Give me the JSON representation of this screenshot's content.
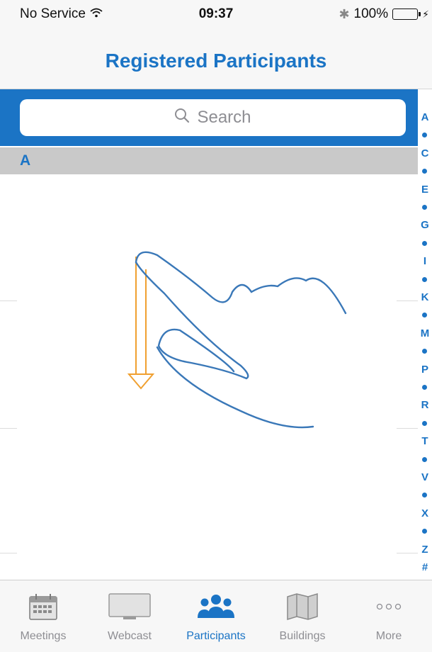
{
  "status_bar": {
    "carrier": "No Service",
    "time": "09:37",
    "battery": "100%"
  },
  "nav": {
    "title": "Registered Participants"
  },
  "search": {
    "placeholder": "Search"
  },
  "section": {
    "letter": "A"
  },
  "index": [
    "A",
    "•",
    "C",
    "•",
    "E",
    "•",
    "G",
    "•",
    "I",
    "•",
    "K",
    "•",
    "M",
    "•",
    "P",
    "•",
    "R",
    "•",
    "T",
    "•",
    "V",
    "•",
    "X",
    "•",
    "Z",
    "#"
  ],
  "tabs": [
    {
      "label": "Meetings",
      "icon": "calendar-icon",
      "active": false
    },
    {
      "label": "Webcast",
      "icon": "monitor-icon",
      "active": false
    },
    {
      "label": "Participants",
      "icon": "people-icon",
      "active": true
    },
    {
      "label": "Buildings",
      "icon": "map-icon",
      "active": false
    },
    {
      "label": "More",
      "icon": "more-icon",
      "active": false
    }
  ],
  "colors": {
    "accent": "#1b74c5",
    "gesture_arrow": "#f0a030",
    "inactive": "#8e8e93"
  }
}
